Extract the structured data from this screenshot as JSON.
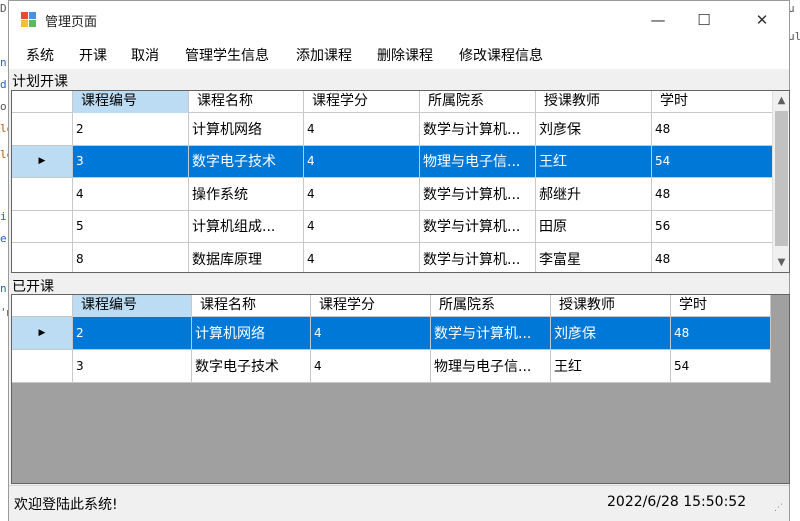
{
  "window": {
    "title": "管理页面",
    "minimize": "—",
    "maximize": "☐",
    "close": "✕"
  },
  "menu": [
    "系统",
    "开课",
    "取消",
    "管理学生信息",
    "添加课程",
    "删除课程",
    "修改课程信息"
  ],
  "planned": {
    "label": "计划开课",
    "columns": [
      "课程编号",
      "课程名称",
      "课程学分",
      "所属院系",
      "授课教师",
      "学时"
    ],
    "selected_row": 1,
    "rows": [
      [
        "2",
        "计算机网络",
        "4",
        "数学与计算机...",
        "刘彦保",
        "48"
      ],
      [
        "3",
        "数字电子技术",
        "4",
        "物理与电子信...",
        "王红",
        "54"
      ],
      [
        "4",
        "操作系统",
        "4",
        "数学与计算机...",
        "郝继升",
        "48"
      ],
      [
        "5",
        "计算机组成...",
        "4",
        "数学与计算机...",
        "田原",
        "56"
      ],
      [
        "8",
        "数据库原理",
        "4",
        "数学与计算机...",
        "李富星",
        "48"
      ]
    ],
    "scroll_up": "▲",
    "scroll_down": "▼"
  },
  "opened": {
    "label": "已开课",
    "columns": [
      "课程编号",
      "课程名称",
      "课程学分",
      "所属院系",
      "授课教师",
      "学时"
    ],
    "selected_row": 0,
    "rows": [
      [
        "2",
        "计算机网络",
        "4",
        "数学与计算机...",
        "刘彦保",
        "48"
      ],
      [
        "3",
        "数字电子技术",
        "4",
        "物理与电子信...",
        "王红",
        "54"
      ]
    ]
  },
  "status": {
    "welcome": "欢迎登陆此系统!",
    "datetime": "2022/6/28 15:50:52"
  },
  "row_marker": "▶",
  "colors": {
    "selection": "#0078d7",
    "header_selected": "#bcdcf4",
    "grid_empty": "#a0a0a0"
  }
}
